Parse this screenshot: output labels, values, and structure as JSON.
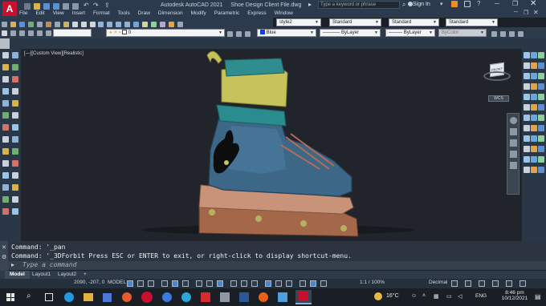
{
  "app": {
    "logo": "A",
    "name": "Autodesk AutoCAD 2021",
    "file": "Shoe Design Client File.dwg",
    "search_placeholder": "Type a keyword or phrase",
    "sign_in": "Sign In"
  },
  "menu": [
    "File",
    "Edit",
    "View",
    "Insert",
    "Format",
    "Tools",
    "Draw",
    "Dimension",
    "Modify",
    "Parametric",
    "Express",
    "Window"
  ],
  "styles": {
    "text_style": "Standard",
    "dim_style": "Standard",
    "table_style": "style2",
    "mleader_style": "Standard"
  },
  "properties": {
    "layer": "0",
    "color": "Blue",
    "linetype": "ByLayer",
    "lineweight": "ByLayer",
    "plotstyle": "ByColor"
  },
  "viewport": {
    "label": "[—][Custom View][Realistic]",
    "nav_home": "⌂",
    "viewcube_face": "FRONT",
    "wcs": "WCS"
  },
  "command": {
    "history": [
      "Command:  '_pan",
      "Command:  '_3DForbit Press ESC or ENTER to exit, or right-click to display shortcut-menu."
    ],
    "placeholder": "Type a command"
  },
  "layouts": [
    "Model",
    "Layout1",
    "Layout2",
    "+"
  ],
  "status": {
    "coordinates": "2090, -207, 0",
    "space": "MODEL",
    "annotation_scale": "1:1 / 100%",
    "units": "Decimal"
  },
  "taskbar": {
    "temperature": "16°C",
    "language": "ENG",
    "time": "8:46 pm",
    "date": "10/12/2021"
  },
  "colors": {
    "shoe_boot": "#3d6786",
    "shoe_collar": "#c6c35a",
    "shoe_teal": "#2a8c8e",
    "sole": "#b0806a",
    "wheels": "#9a6a45",
    "accent_red": "#c8102e"
  }
}
